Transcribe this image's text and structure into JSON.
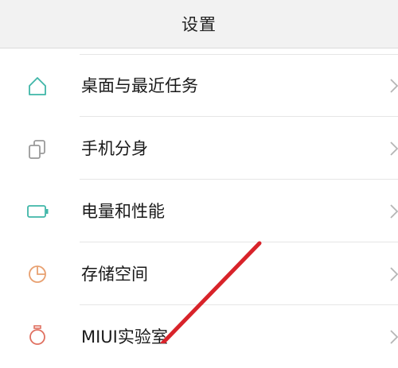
{
  "header": {
    "title": "设置"
  },
  "items": [
    {
      "label": "桌面与最近任务",
      "icon": "home-icon",
      "icon_color": "#3fb6a8"
    },
    {
      "label": "手机分身",
      "icon": "clone-icon",
      "icon_color": "#9a9a9a"
    },
    {
      "label": "电量和性能",
      "icon": "battery-icon",
      "icon_color": "#3fb6a8"
    },
    {
      "label": "存储空间",
      "icon": "storage-pie-icon",
      "icon_color": "#e8a070"
    },
    {
      "label": "MIUI实验室",
      "icon": "flask-icon",
      "icon_color": "#e07060"
    }
  ],
  "annotation": {
    "color": "#d8232a"
  }
}
